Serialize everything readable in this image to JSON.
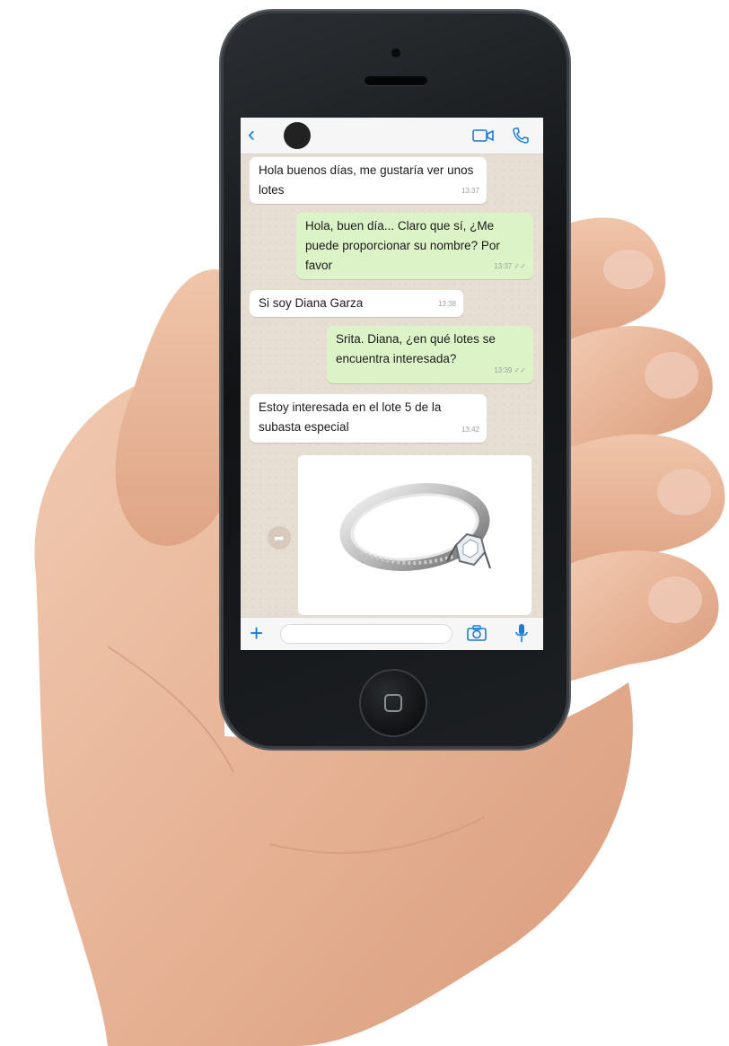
{
  "header": {
    "back_icon": "chevron-left-icon",
    "video_icon": "video-camera-icon",
    "call_icon": "phone-icon"
  },
  "messages": [
    {
      "direction": "in",
      "text": "Hola buenos días,  me gustaría ver unos lotes",
      "time": "13:37"
    },
    {
      "direction": "out",
      "text": "Hola, buen día... Claro que sí, ¿Me puede proporcionar su nombre? Por favor",
      "time": "13:37 ✓✓"
    },
    {
      "direction": "in",
      "text": "Si soy Diana Garza",
      "time": "13:38"
    },
    {
      "direction": "out",
      "text": "Srita. Diana, ¿en qué lotes se encuentra interesada?",
      "time": "13:39 ✓✓"
    },
    {
      "direction": "in",
      "text": "Estoy interesada en el lote 5 de la subasta especial",
      "time": "13:42"
    }
  ],
  "image_message": {
    "subject": "diamond engagement ring"
  },
  "input_bar": {
    "add_icon": "plus-icon",
    "camera_icon": "camera-icon",
    "mic_icon": "microphone-icon",
    "placeholder": ""
  },
  "colors": {
    "accent": "#1c7cd6",
    "outgoing_bubble": "#dcf3c8",
    "incoming_bubble": "#ffffff",
    "chat_background": "#e6ddd3"
  }
}
